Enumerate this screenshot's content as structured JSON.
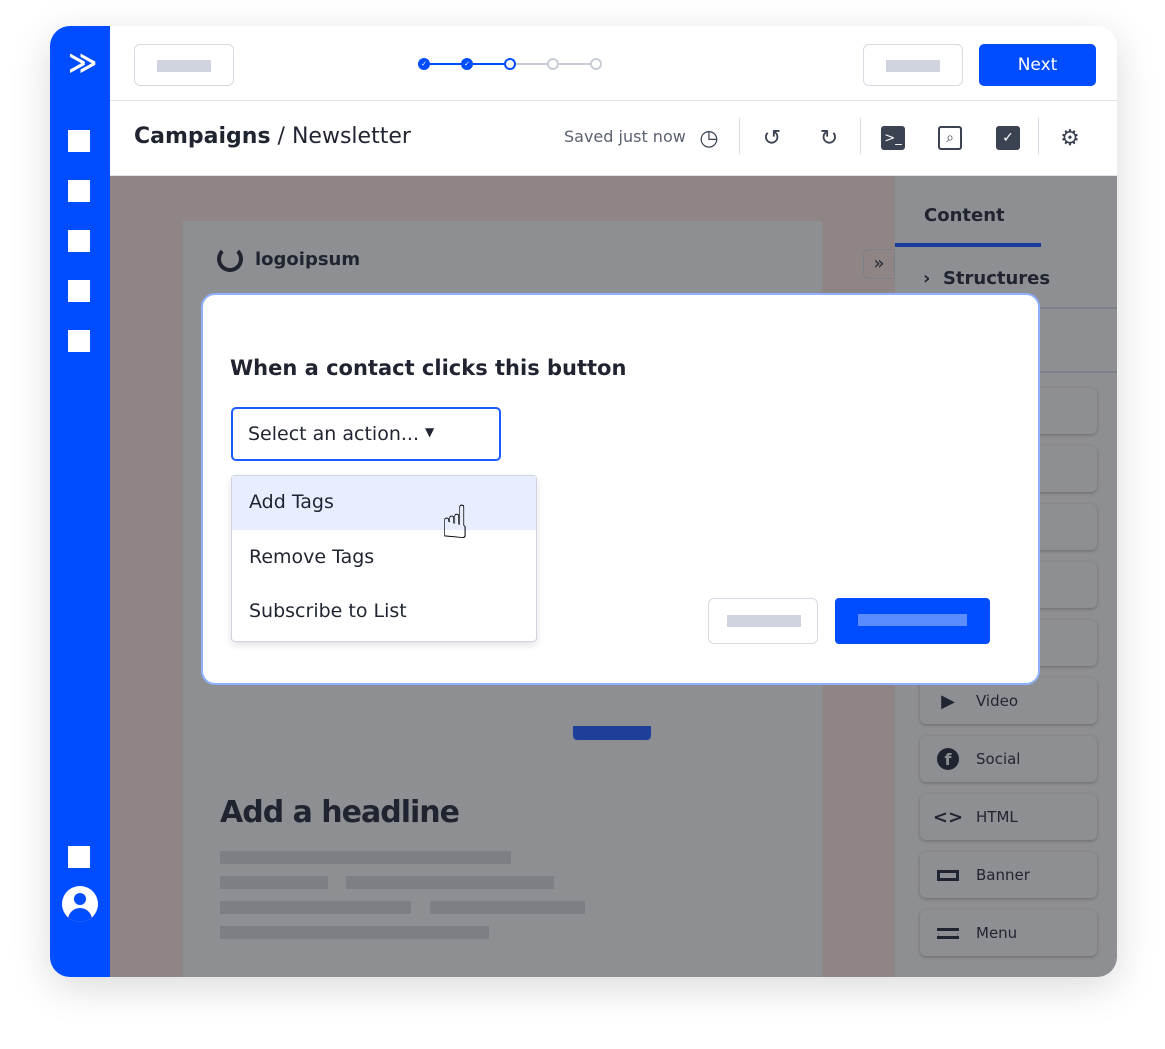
{
  "topbar": {
    "next_label": "Next",
    "steps": [
      {
        "state": "done"
      },
      {
        "state": "done"
      },
      {
        "state": "current"
      },
      {
        "state": "todo"
      },
      {
        "state": "todo"
      }
    ]
  },
  "header": {
    "crumb_root": "Campaigns",
    "crumb_sep": " / ",
    "crumb_page": "Newsletter",
    "save_status": "Saved just now"
  },
  "email": {
    "logo_text": "logoipsum",
    "headline": "Add a headline"
  },
  "panel": {
    "tab_content": "Content",
    "structures": "Structures",
    "blocks": [
      {
        "label": "Video",
        "icon": "play-icon"
      },
      {
        "label": "Social",
        "icon": "facebook-icon"
      },
      {
        "label": "HTML",
        "icon": "code-icon"
      },
      {
        "label": "Banner",
        "icon": "banner-icon"
      },
      {
        "label": "Menu",
        "icon": "menu-icon"
      }
    ]
  },
  "modal": {
    "title": "When a contact clicks this button",
    "select_value": "Select an action...",
    "options": [
      "Add Tags",
      "Remove Tags",
      "Subscribe to List"
    ],
    "highlighted_option": "Add Tags"
  },
  "colors": {
    "brand": "#004cff",
    "overlay": "#8e8f93"
  }
}
